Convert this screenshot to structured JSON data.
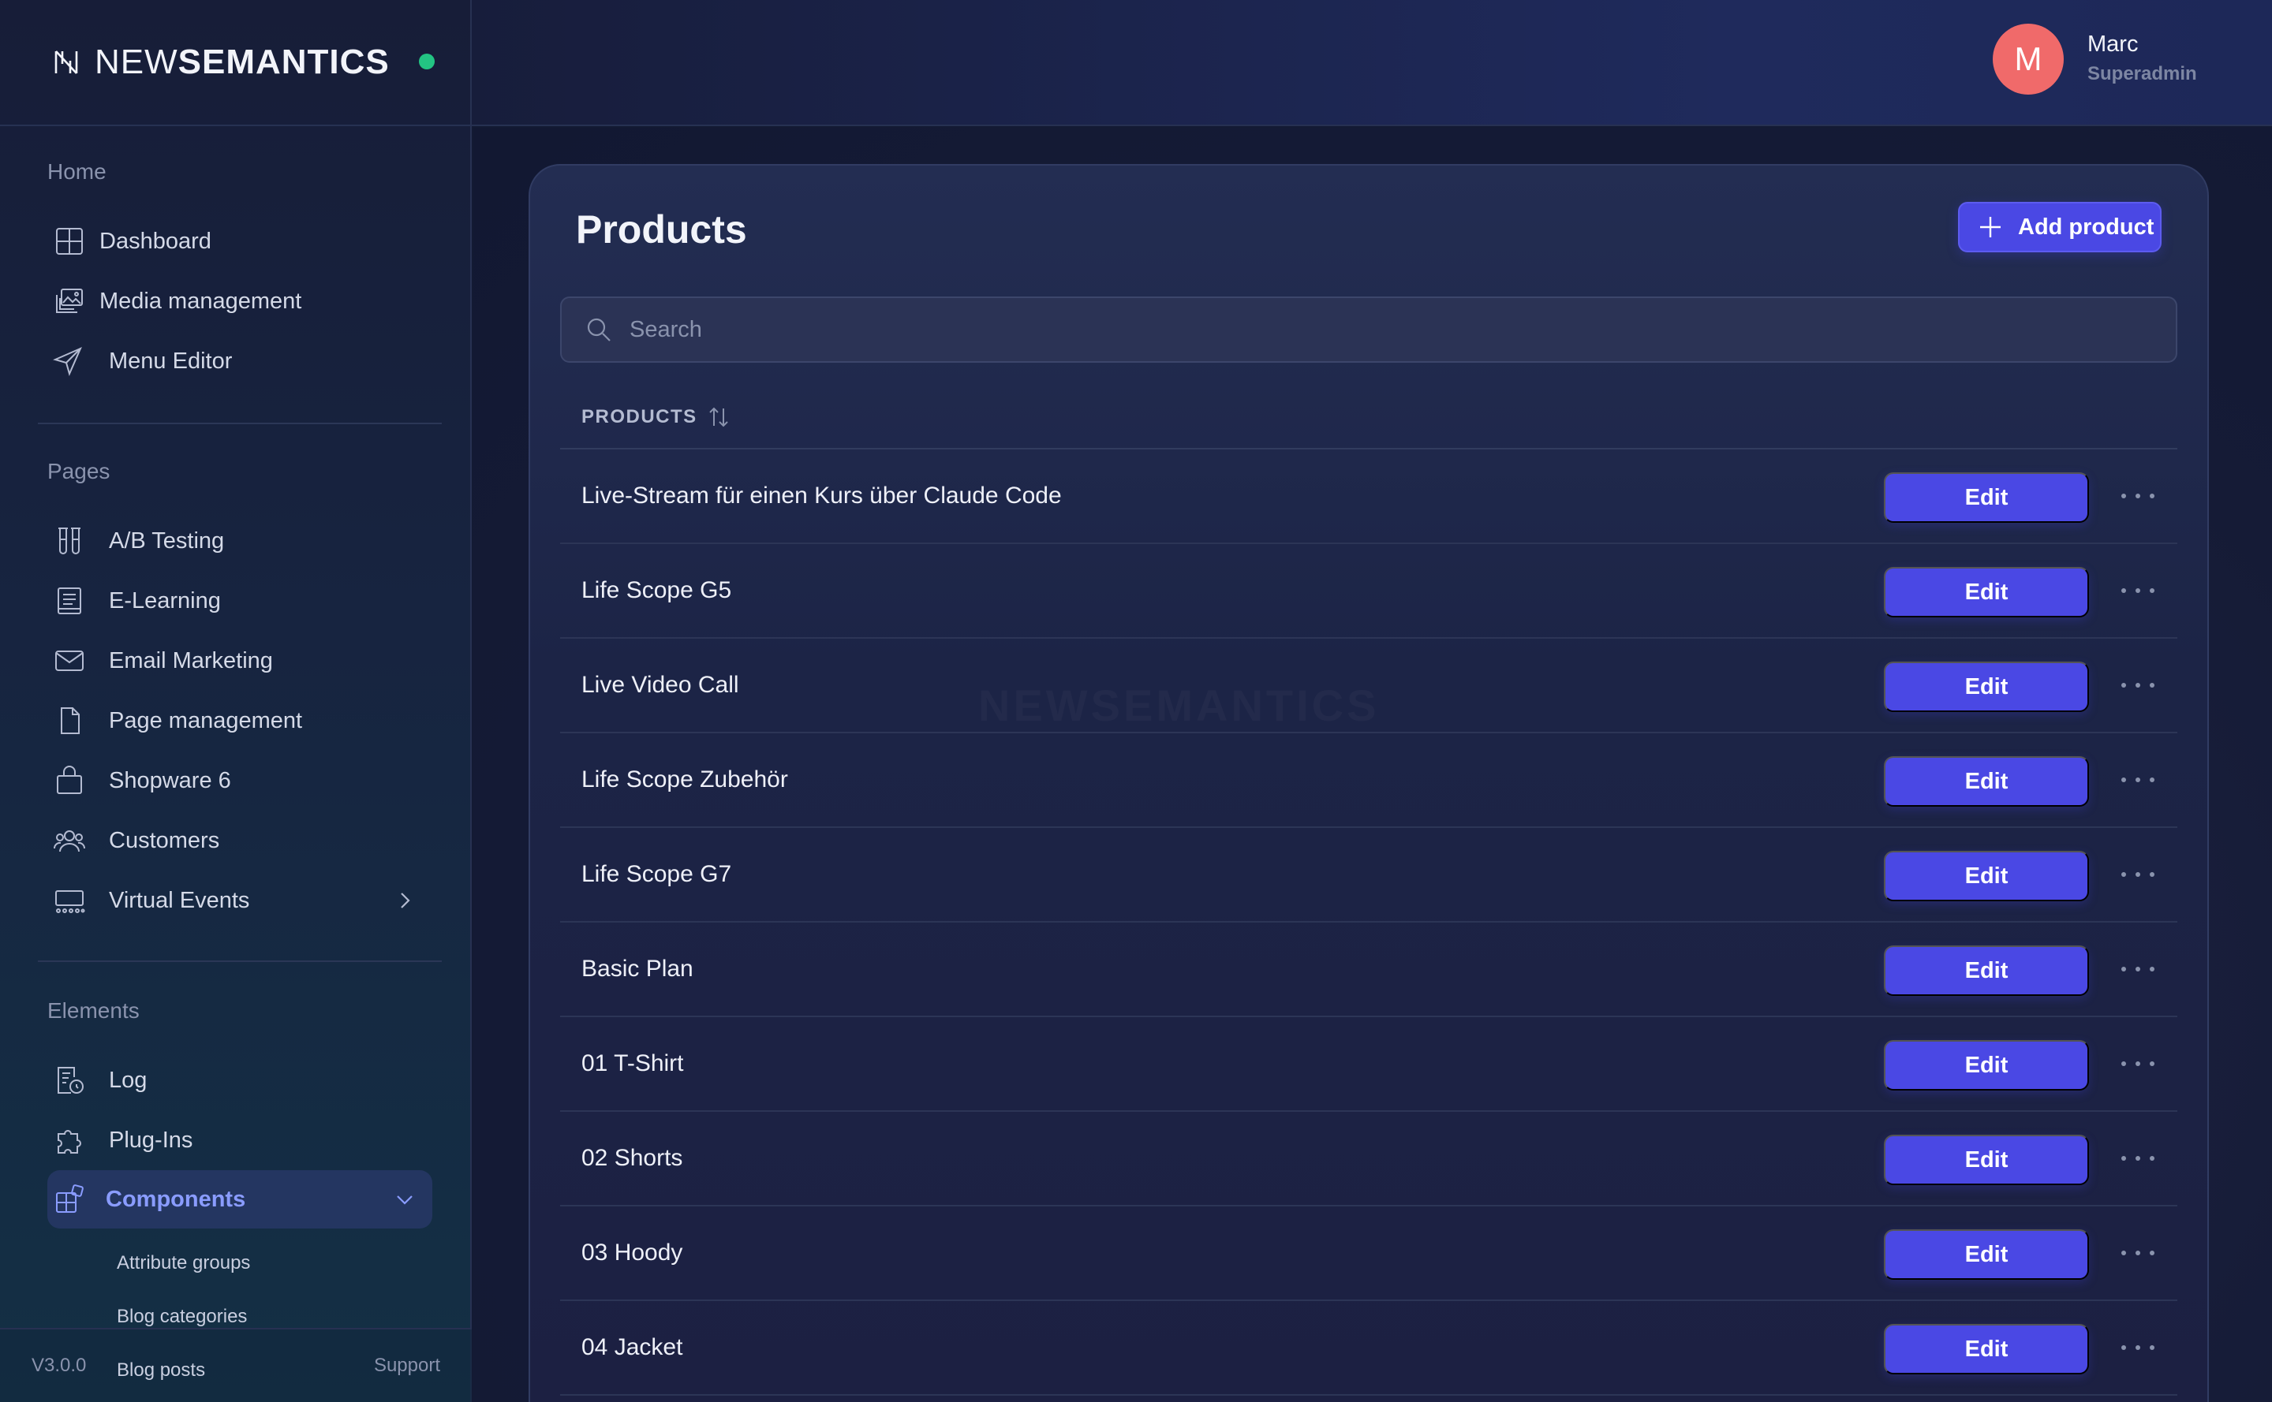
{
  "brand": {
    "name_light": "NEW",
    "name_bold": "SEMANTICS"
  },
  "user": {
    "initial": "M",
    "name": "Marc",
    "role": "Superadmin"
  },
  "sidebar": {
    "sections": [
      {
        "title": "Home",
        "items": [
          {
            "label": "Dashboard",
            "icon": "grid-icon"
          },
          {
            "label": "Media management",
            "icon": "images-icon"
          },
          {
            "label": "Menu Editor",
            "icon": "send-icon"
          }
        ]
      },
      {
        "title": "Pages",
        "items": [
          {
            "label": "A/B Testing",
            "icon": "test-tubes-icon"
          },
          {
            "label": "E-Learning",
            "icon": "book-icon"
          },
          {
            "label": "Email Marketing",
            "icon": "mail-icon"
          },
          {
            "label": "Page management",
            "icon": "file-icon"
          },
          {
            "label": "Shopware 6",
            "icon": "shopping-bag-icon"
          },
          {
            "label": "Customers",
            "icon": "users-icon"
          },
          {
            "label": "Virtual Events",
            "icon": "events-icon"
          }
        ]
      },
      {
        "title": "Elements",
        "items": [
          {
            "label": "Log",
            "icon": "log-icon"
          },
          {
            "label": "Plug-Ins",
            "icon": "puzzle-icon"
          },
          {
            "label": "Components",
            "icon": "components-icon",
            "active": true
          }
        ]
      }
    ],
    "sub_items": [
      "Attribute groups",
      "Blog categories",
      "Blog posts"
    ],
    "footer": {
      "version": "V3.0.0",
      "support": "Support"
    }
  },
  "main": {
    "title": "Products",
    "add_button": "Add product",
    "search_placeholder": "Search",
    "column_header": "PRODUCTS",
    "edit_label": "Edit",
    "watermark": "NEWSEMANTICS",
    "products": [
      "Live-Stream für einen Kurs über Claude Code",
      "Life Scope G5",
      "Live Video Call",
      "Life Scope Zubehör",
      "Life Scope G7",
      "Basic Plan",
      "01 T-Shirt",
      "02 Shorts",
      "03 Hoody",
      "04 Jacket"
    ]
  },
  "colors": {
    "accent": "#4a48e4",
    "status_online": "#23c483",
    "avatar": "#f06a6a",
    "active_text": "#8a9cff"
  }
}
